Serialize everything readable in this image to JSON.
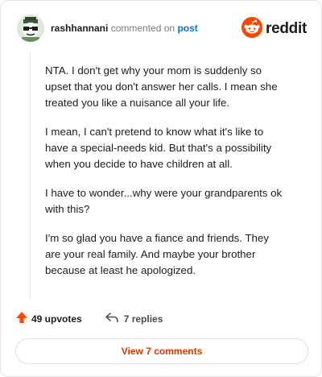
{
  "header": {
    "username": "rashhannani",
    "action_text": "commented on",
    "post_link": "post",
    "brand_name": "reddit"
  },
  "comment": {
    "paragraphs": [
      "NTA. I don't get why your mom is suddenly so upset that you don't answer her calls. I mean she treated you like a nuisance all your life.",
      "I mean, I can't pretend to know what it's like to have a special-needs kid. But that's a possibility when you decide to have children at all.",
      "I have to wonder...why were your grandparents ok with this?",
      "I'm so glad you have a fiance and friends. They are your real family. And maybe your brother because at least he apologized."
    ]
  },
  "footer": {
    "upvotes_label": "49 upvotes",
    "replies_label": "7 replies"
  },
  "view_button": {
    "label": "View 7 comments"
  },
  "colors": {
    "brand_orange": "#ff4500",
    "link_blue": "#0079d3",
    "button_text": "#d93a00"
  },
  "icons": {
    "upvote": "upvote-arrow-icon",
    "reply": "reply-arrow-icon",
    "brand": "reddit-snoo-icon"
  }
}
